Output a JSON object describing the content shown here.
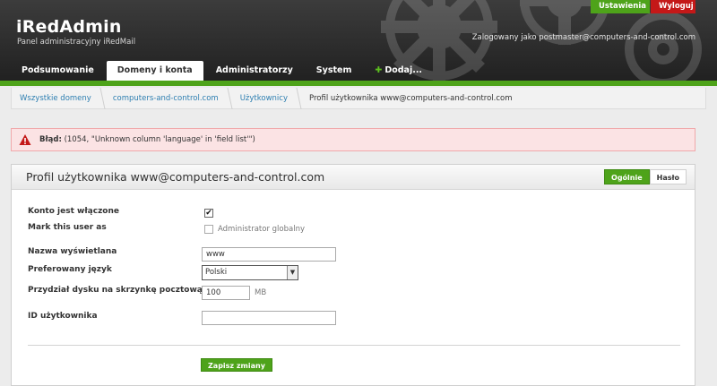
{
  "header": {
    "app_title": "iRedAdmin",
    "app_subtitle": "Panel administracyjny iRedMail",
    "logged_in_text": "Zalogowany jako postmaster@computers-and-control.com",
    "settings_label": "Ustawienia",
    "logout_label": "Wyloguj"
  },
  "nav": {
    "items": [
      {
        "label": "Podsumowanie"
      },
      {
        "label": "Domeny i konta"
      },
      {
        "label": "Administratorzy"
      },
      {
        "label": "System"
      },
      {
        "label": "Dodaj..."
      }
    ]
  },
  "breadcrumb": {
    "items": [
      {
        "label": "Wszystkie domeny"
      },
      {
        "label": "computers-and-control.com"
      },
      {
        "label": "Użytkownicy"
      },
      {
        "label": "Profil użytkownika www@computers-and-control.com"
      }
    ]
  },
  "error": {
    "label": "Błąd:",
    "message": "(1054, \"Unknown column 'language' in 'field list'\")"
  },
  "panel": {
    "title": "Profil użytkownika www@computers-and-control.com",
    "tabs": [
      {
        "label": "Ogólnie"
      },
      {
        "label": "Hasło"
      }
    ]
  },
  "form": {
    "enabled_label": "Konto jest włączone",
    "enabled_checked": true,
    "mark_label": "Mark this user as",
    "global_admin_label": "Administrator globalny",
    "global_admin_checked": false,
    "display_name_label": "Nazwa wyświetlana",
    "display_name_value": "www",
    "language_label": "Preferowany język",
    "language_value": "Polski",
    "quota_label": "Przydział dysku na skrzynkę pocztową",
    "quota_value": "100",
    "quota_unit": "MB",
    "user_id_label": "ID użytkownika",
    "user_id_value": "",
    "save_label": "Zapisz zmiany"
  },
  "colors": {
    "accent_green": "#4ea31a",
    "logout_red": "#c41818",
    "link_blue": "#2e7fb1",
    "error_bg": "#fbe3e4"
  },
  "icons": {
    "error": "warning-icon",
    "checkbox": "checkmark-icon",
    "dropdown": "chevron-down-icon"
  }
}
